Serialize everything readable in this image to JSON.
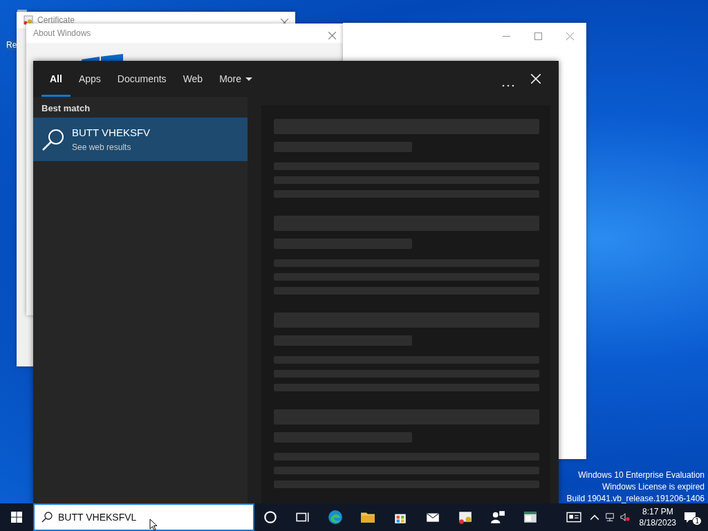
{
  "desktop": {
    "icon_label": "Re",
    "notice": [
      "Windows 10 Enterprise Evaluation",
      "Windows License is expired",
      "Build 19041.vb_release.191206-1406"
    ]
  },
  "windows": [
    {
      "title": "Certificate"
    },
    {
      "title": "About Windows"
    }
  ],
  "search_panel": {
    "tabs": [
      {
        "label": "All",
        "selected": true,
        "kind": "plain"
      },
      {
        "label": "Apps",
        "selected": false,
        "kind": "plain"
      },
      {
        "label": "Documents",
        "selected": false,
        "kind": "plain"
      },
      {
        "label": "Web",
        "selected": false,
        "kind": "plain"
      },
      {
        "label": "More",
        "selected": false,
        "kind": "dropdown"
      }
    ],
    "section_heading": "Best match",
    "results": [
      {
        "title": "BUTT VHEKSFV",
        "subtitle": "See web results",
        "selected": true
      }
    ]
  },
  "taskbar": {
    "search": {
      "value": "BUTT VHEKSFVL"
    },
    "clock": {
      "time": "8:17 PM",
      "date": "8/18/2023"
    },
    "notification_count": "1"
  }
}
